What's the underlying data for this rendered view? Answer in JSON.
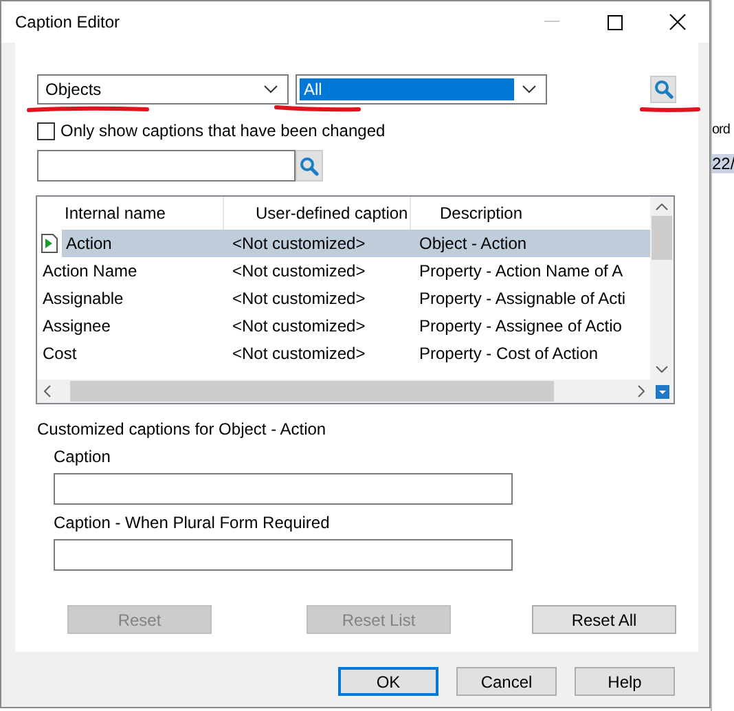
{
  "window": {
    "title": "Caption Editor"
  },
  "filters": [
    {
      "value": "Objects",
      "highlighted": false
    },
    {
      "value": "All",
      "highlighted": true
    }
  ],
  "changed_only": {
    "label": "Only show captions that have been changed",
    "checked": false
  },
  "table": {
    "columns": [
      "Internal name",
      "User-defined caption",
      "Description"
    ],
    "rows": [
      {
        "cells": [
          "Action",
          "<Not customized>",
          "Object - Action"
        ],
        "selected": true
      },
      {
        "cells": [
          "Action Name",
          "<Not customized>",
          "Property - Action Name of A"
        ],
        "selected": false
      },
      {
        "cells": [
          "Assignable",
          "<Not customized>",
          "Property - Assignable of Acti"
        ],
        "selected": false
      },
      {
        "cells": [
          "Assignee",
          "<Not customized>",
          "Property - Assignee of Actio"
        ],
        "selected": false
      },
      {
        "cells": [
          "Cost",
          "<Not customized>",
          "Property - Cost of Action"
        ],
        "selected": false
      }
    ]
  },
  "details": {
    "heading": "Customized captions for Object - Action",
    "fields": [
      {
        "label": "Caption"
      },
      {
        "label": "Caption - When Plural Form Required"
      }
    ]
  },
  "action_buttons": [
    {
      "label": "Reset",
      "disabled": true
    },
    {
      "label": "Reset List",
      "disabled": true
    },
    {
      "label": "Reset All",
      "disabled": false
    }
  ],
  "dialog_buttons": [
    {
      "label": "OK",
      "default": true
    },
    {
      "label": "Cancel",
      "default": false
    },
    {
      "label": "Help",
      "default": false
    }
  ],
  "background": {
    "texts": [
      "ord",
      "22/"
    ]
  }
}
